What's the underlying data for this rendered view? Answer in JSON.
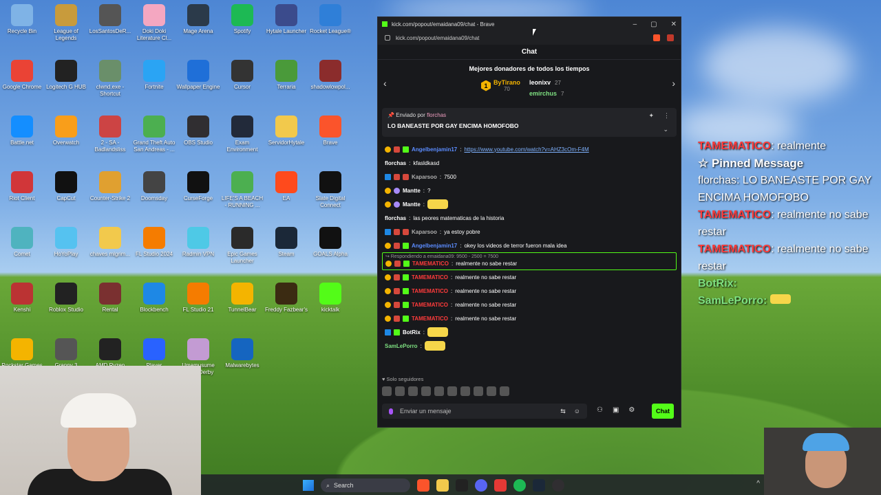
{
  "desktop_icons": [
    {
      "label": "Recycle Bin",
      "icon": "recycle-bin-icon",
      "color": "#7fb3e6"
    },
    {
      "label": "League of Legends",
      "icon": "league-of-legends-icon",
      "color": "#c89b3c"
    },
    {
      "label": "LosSantosDeR...",
      "icon": "los-santos-icon",
      "color": "#555555"
    },
    {
      "label": "Doki Doki Literature Cl...",
      "icon": "doki-doki-icon",
      "color": "#f4a7c1"
    },
    {
      "label": "Mage Arena",
      "icon": "mage-arena-icon",
      "color": "#2b3a4a"
    },
    {
      "label": "Spotify",
      "icon": "spotify-icon",
      "color": "#1db954"
    },
    {
      "label": "Hytale Launcher",
      "icon": "hytale-icon",
      "color": "#3b4b8c"
    },
    {
      "label": "Rocket League®",
      "icon": "rocket-league-icon",
      "color": "#2f7fd8"
    },
    {
      "label": "Google Chrome",
      "icon": "chrome-icon",
      "color": "#ea4335"
    },
    {
      "label": "Logitech G HUB",
      "icon": "logitech-icon",
      "color": "#222222"
    },
    {
      "label": "clwnd.exe - Shortcut",
      "icon": "clwnd-icon",
      "color": "#6a8f6a"
    },
    {
      "label": "Fortnite",
      "icon": "fortnite-icon",
      "color": "#2aa4f4"
    },
    {
      "label": "Wallpaper Engine",
      "icon": "wallpaper-engine-icon",
      "color": "#1f6fd8"
    },
    {
      "label": "Cursor",
      "icon": "cursor-app-icon",
      "color": "#333333"
    },
    {
      "label": "Terraria",
      "icon": "terraria-icon",
      "color": "#4a9a3a"
    },
    {
      "label": "shadowlowpol...",
      "icon": "winrar-icon",
      "color": "#8b2c2c"
    },
    {
      "label": "Battle.net",
      "icon": "battlenet-icon",
      "color": "#148eff"
    },
    {
      "label": "Overwatch",
      "icon": "overwatch-icon",
      "color": "#f99e1a"
    },
    {
      "label": "2 - SA - Badlandsliss",
      "icon": "gta-sa-icon",
      "color": "#c44"
    },
    {
      "label": "Grand Theft Auto San Andreas - ...",
      "icon": "gta-icon",
      "color": "#4caf50"
    },
    {
      "label": "OBS Studio",
      "icon": "obs-icon",
      "color": "#302e31"
    },
    {
      "label": "Exam Environment",
      "icon": "exam-icon",
      "color": "#222a3a"
    },
    {
      "label": "ServidorHytale",
      "icon": "folder-icon",
      "color": "#f2c94c"
    },
    {
      "label": "Brave",
      "icon": "brave-icon",
      "color": "#fb542b"
    },
    {
      "label": "Riot Client",
      "icon": "riot-icon",
      "color": "#d13639"
    },
    {
      "label": "CapCut",
      "icon": "capcut-icon",
      "color": "#111111"
    },
    {
      "label": "Counter-Strike 2",
      "icon": "cs2-icon",
      "color": "#e0a030"
    },
    {
      "label": "Doomsday",
      "icon": "doomsday-icon",
      "color": "#444444"
    },
    {
      "label": "CurseForge",
      "icon": "curseforge-icon",
      "color": "#111111"
    },
    {
      "label": "LIFE'S A BEACH - RUNNING ...",
      "icon": "life-beach-icon",
      "color": "#4caf50"
    },
    {
      "label": "EA",
      "icon": "ea-icon",
      "color": "#ff4a1c"
    },
    {
      "label": "Slate Digital Connect",
      "icon": "slate-icon",
      "color": "#111111"
    },
    {
      "label": "Comet",
      "icon": "comet-icon",
      "color": "#4fb3bf"
    },
    {
      "label": "HoYoPlay",
      "icon": "hoyoplay-icon",
      "color": "#55c2f0"
    },
    {
      "label": "chaves mlgrim...",
      "icon": "folder-icon",
      "color": "#f2c94c"
    },
    {
      "label": "FL Studio 2024",
      "icon": "fl-studio-icon",
      "color": "#f57c00"
    },
    {
      "label": "Radmin VPN",
      "icon": "radmin-icon",
      "color": "#4ec9e6"
    },
    {
      "label": "Epic Games Launcher",
      "icon": "epic-games-icon",
      "color": "#2a2a2a"
    },
    {
      "label": "Steam",
      "icon": "steam-icon",
      "color": "#1b2838"
    },
    {
      "label": "GOALS Alpha",
      "icon": "goals-icon",
      "color": "#111111"
    },
    {
      "label": "Kenshi",
      "icon": "kenshi-icon",
      "color": "#b33"
    },
    {
      "label": "Roblox Studio",
      "icon": "roblox-icon",
      "color": "#222222"
    },
    {
      "label": "Rental",
      "icon": "rental-icon",
      "color": "#7a3030"
    },
    {
      "label": "Blockbench",
      "icon": "blockbench-icon",
      "color": "#1e88e5"
    },
    {
      "label": "FL Studio 21",
      "icon": "fl-studio-21-icon",
      "color": "#f57c00"
    },
    {
      "label": "TunnelBear",
      "icon": "tunnelbear-icon",
      "color": "#f4b400"
    },
    {
      "label": "Freddy Fazbear's",
      "icon": "fnaf-icon",
      "color": "#3b2b12"
    },
    {
      "label": "kicktalk",
      "icon": "kicktalk-icon",
      "color": "#53fc18"
    },
    {
      "label": "Rockstar Games Launcher",
      "icon": "rockstar-icon",
      "color": "#f4b400"
    },
    {
      "label": "Granny 3",
      "icon": "granny-icon",
      "color": "#555555"
    },
    {
      "label": "AMD Ryzen Master",
      "icon": "amd-icon",
      "color": "#222222"
    },
    {
      "label": "Player",
      "icon": "player-icon",
      "color": "#2962ff"
    },
    {
      "label": "Umamusume Pretty Derby",
      "icon": "umamusume-icon",
      "color": "#c39bd3"
    },
    {
      "label": "Malwarebytes",
      "icon": "malwarebytes-icon",
      "color": "#1565c0"
    }
  ],
  "browser": {
    "title": "kick.com/popout/emaidana09/chat - Brave",
    "url": "kick.com/popout/emaidana09/chat",
    "controls": {
      "minimize": "–",
      "maximize": "▢",
      "close": "✕"
    }
  },
  "chat": {
    "header": "Chat",
    "donors_title": "Mejores donadores de todos los tiempos",
    "donors": [
      {
        "rank": "1",
        "name": "ByTirano",
        "amount": "70",
        "color": "#f4b400"
      },
      {
        "name": "leonixv",
        "amount": "27",
        "color": "#ffffff"
      },
      {
        "name": "emirchus",
        "amount": "7",
        "color": "#7ee081"
      }
    ],
    "pinned": {
      "sent_by_label": "Enviado por",
      "sent_by_user": "florchas",
      "message": "LO BANEASTE POR GAY ENCIMA HOMOFOBO"
    },
    "messages": [
      {
        "user": "Angelbenjamin17",
        "user_class": "u-blue",
        "badges": [
          "b-gold",
          "b-red",
          "b-green"
        ],
        "text": "",
        "link": "https://www.youtube.com/watch?v=AHZ3cOm-F4M"
      },
      {
        "user": "florchas",
        "user_class": "u-white",
        "badges": [],
        "text": "kfasldkasd",
        "link": ""
      },
      {
        "user": "Kaparsoo",
        "user_class": "u-gray",
        "badges": [
          "b-blue",
          "b-red",
          "b-red"
        ],
        "text": "7500",
        "link": ""
      },
      {
        "user": "Mantte",
        "user_class": "u-white",
        "badges": [
          "b-gold",
          "b-purple"
        ],
        "text": "?",
        "link": ""
      },
      {
        "user": "Mantte",
        "user_class": "u-white",
        "badges": [
          "b-gold",
          "b-purple"
        ],
        "text": "",
        "link": "",
        "emote": true
      },
      {
        "user": "florchas",
        "user_class": "u-white",
        "badges": [],
        "text": "las peores matematicas de la historia",
        "link": ""
      },
      {
        "user": "Kaparsoo",
        "user_class": "u-gray",
        "badges": [
          "b-blue",
          "b-red",
          "b-red"
        ],
        "text": "ya estoy pobre",
        "link": ""
      },
      {
        "user": "Angelbenjamin17",
        "user_class": "u-blue",
        "badges": [
          "b-gold",
          "b-red",
          "b-green"
        ],
        "text": "okey los videos de terror fueron mala idea",
        "link": ""
      }
    ],
    "reply": {
      "meta": "Respondiendo a emaidana09: 9500 - 2500 = 7500",
      "user": "TAMEMATICO",
      "text": "realmente no sabe restar"
    },
    "repeat_messages": [
      {
        "user": "TAMEMATICO",
        "text": "realmente no sabe restar"
      },
      {
        "user": "TAMEMATICO",
        "text": "realmente no sabe restar"
      },
      {
        "user": "TAMEMATICO",
        "text": "realmente no sabe restar"
      },
      {
        "user": "TAMEMATICO",
        "text": "realmente no sabe restar"
      }
    ],
    "bot": {
      "user": "BotRix"
    },
    "sam": {
      "user": "SamLePorro"
    },
    "followers_only": "Solo seguidores",
    "input_placeholder": "Enviar un mensaje",
    "send_label": "Chat"
  },
  "overlay": {
    "top_user": "TAMEMATICO",
    "top_text": "realmente",
    "pinned_title": "Pinned Message",
    "pinned_user": "florchas:",
    "pinned_text": "LO BANEASTE POR GAY ENCIMA HOMOFOBO",
    "line_user": "TAMEMATICO",
    "line_text": "realmente no sabe restar",
    "line2_user": "TAMEMATICO",
    "line2_text": "realmente no sabe restar",
    "bot_user": "BotRix:",
    "sam_user": "SamLePorro:"
  },
  "taskbar": {
    "search_label": "Search"
  }
}
